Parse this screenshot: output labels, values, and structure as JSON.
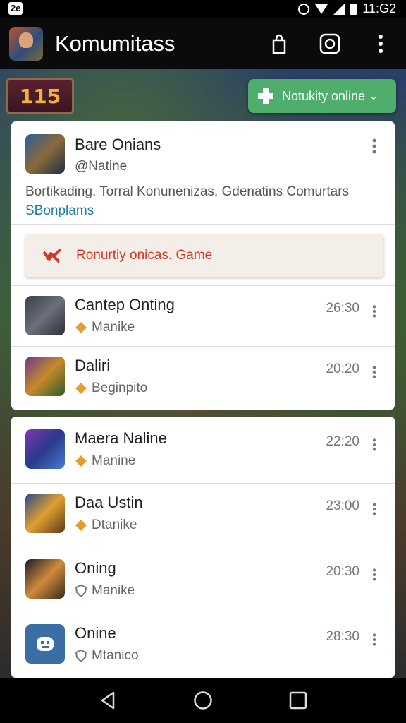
{
  "status_bar": {
    "left_badge": "2e",
    "time": "11:G2"
  },
  "app_bar": {
    "title": "Komumitass"
  },
  "level_badge": {
    "value": "115"
  },
  "online_button": {
    "label": "Notukity online"
  },
  "featured": {
    "name": "Bare Onians",
    "handle": "@Natine",
    "desc_main": "Bortikading. Torral Konunenizas, Gdenatins Comurtars",
    "desc_link": "SBonplams"
  },
  "alert": {
    "text": "Ronurtiy onicas. Game"
  },
  "rows_card1": [
    {
      "name": "Cantep Onting",
      "sub": "Manike",
      "time": "26:30"
    },
    {
      "name": "Daliri",
      "sub": "Beginpito",
      "time": "20:20"
    }
  ],
  "rows_card2": [
    {
      "name": "Maera Naline",
      "sub": "Manine",
      "time": "22:20"
    },
    {
      "name": "Daa Ustin",
      "sub": "Dtanike",
      "time": "23:00"
    },
    {
      "name": "Oning",
      "sub": "Manike",
      "time": "20:30"
    },
    {
      "name": "Onine",
      "sub": "Mtanico",
      "time": "28:30"
    }
  ],
  "colors": {
    "accent_green": "#4fae6c",
    "alert_red": "#d13a2a",
    "link_blue": "#1e7fa8"
  }
}
